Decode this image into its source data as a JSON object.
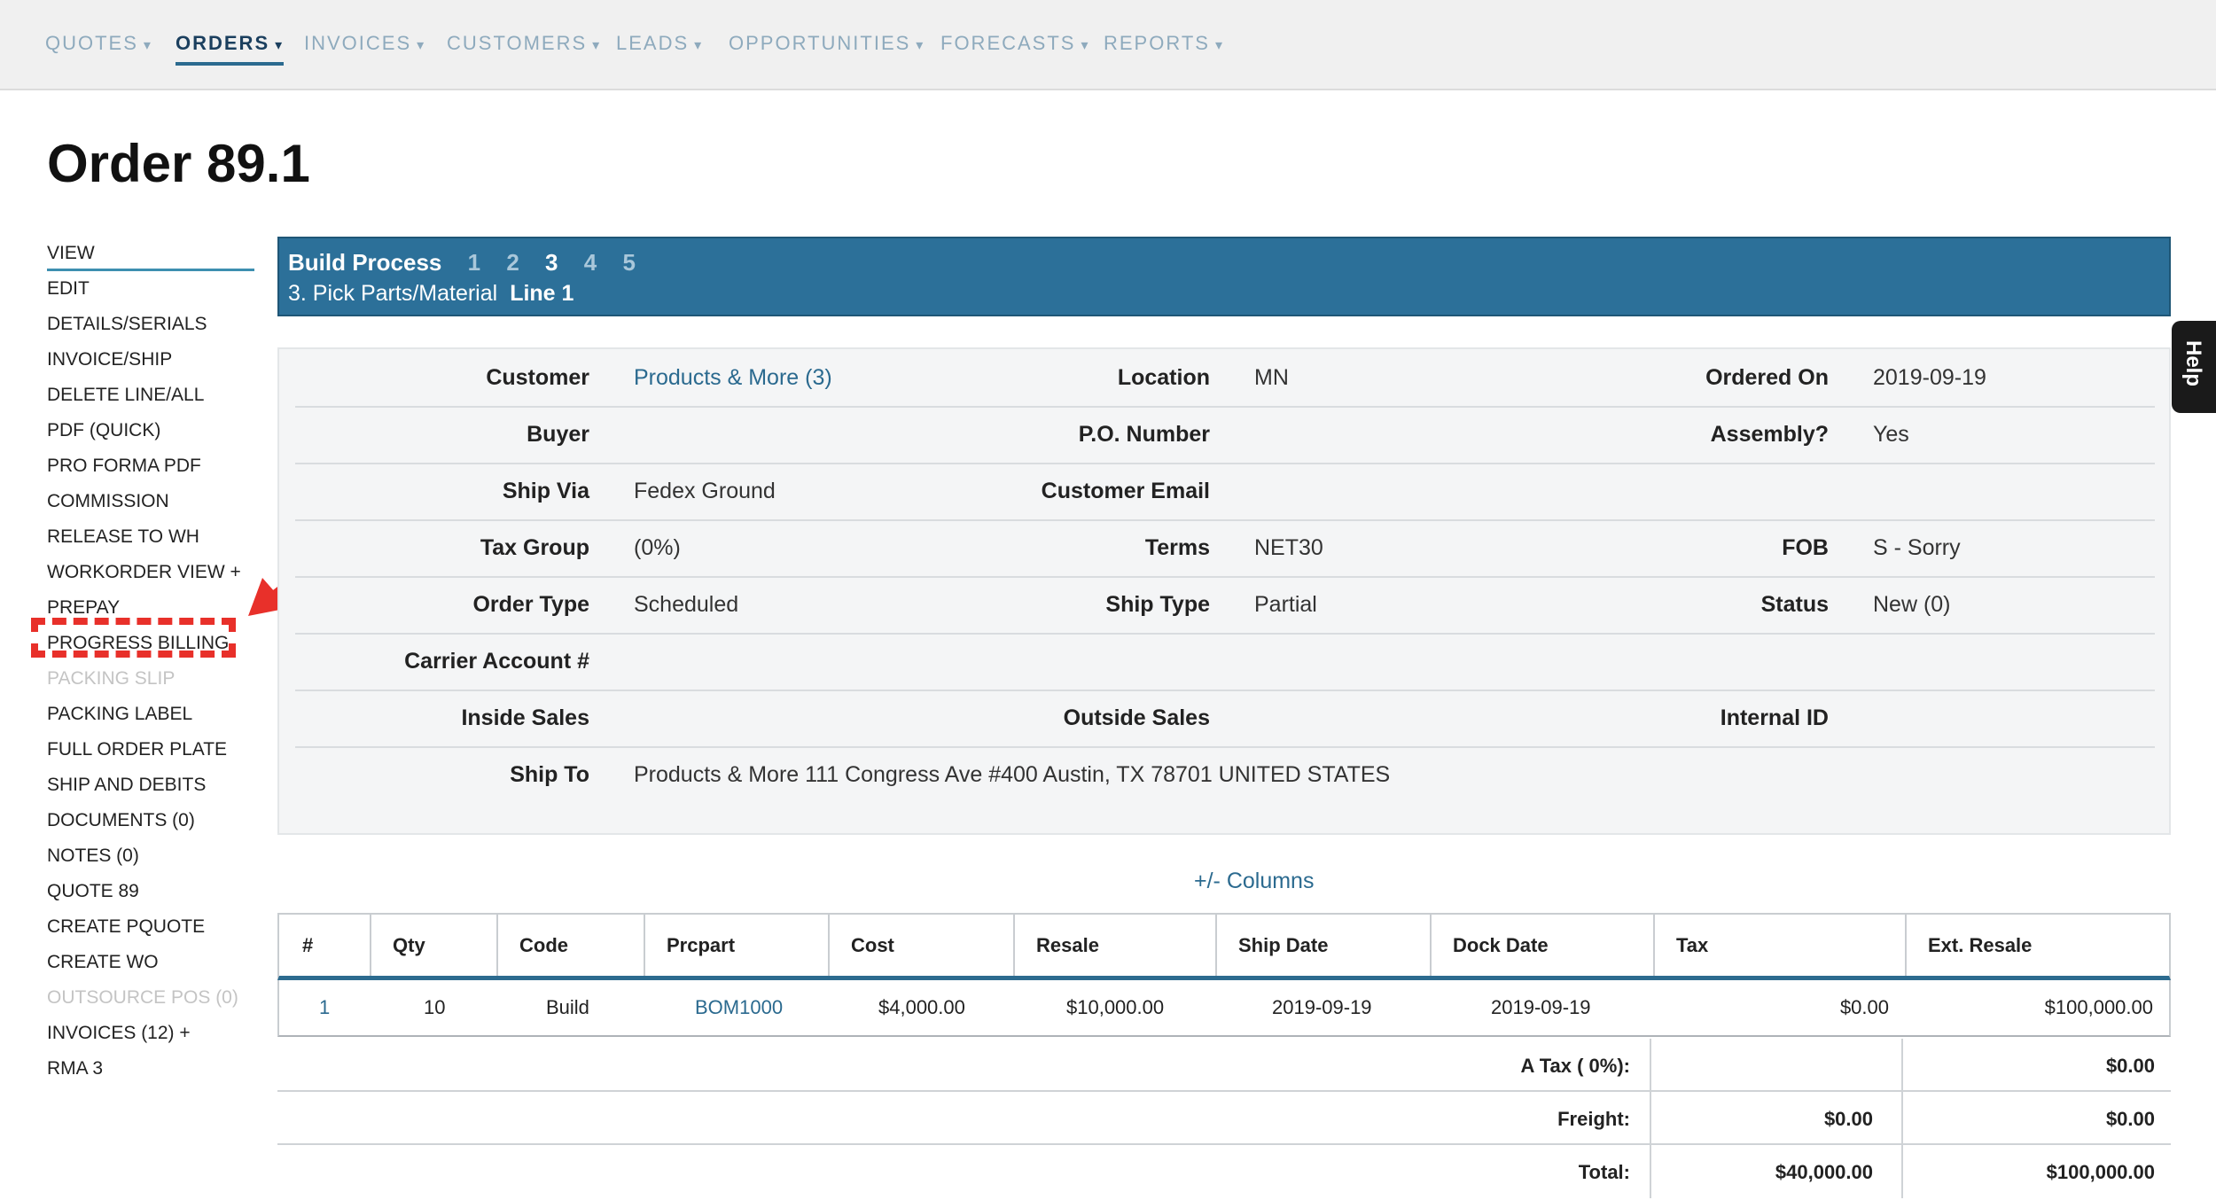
{
  "nav": [
    {
      "label": "QUOTES",
      "active": false
    },
    {
      "label": "ORDERS",
      "active": true
    },
    {
      "label": "INVOICES",
      "active": false
    },
    {
      "label": "CUSTOMERS",
      "active": false
    },
    {
      "label": "LEADS",
      "active": false
    },
    {
      "label": "OPPORTUNITIES",
      "active": false
    },
    {
      "label": "FORECASTS",
      "active": false
    },
    {
      "label": "REPORTS",
      "active": false
    }
  ],
  "nav_caret": "▾",
  "page": {
    "title": "Order 89.1"
  },
  "sidebar": [
    {
      "label": "VIEW",
      "state": "current"
    },
    {
      "label": "EDIT",
      "state": "normal"
    },
    {
      "label": "DETAILS/SERIALS",
      "state": "normal"
    },
    {
      "label": "INVOICE/SHIP",
      "state": "normal"
    },
    {
      "label": "DELETE LINE/ALL",
      "state": "normal"
    },
    {
      "label": "PDF (QUICK)",
      "state": "normal"
    },
    {
      "label": "PRO FORMA PDF",
      "state": "normal"
    },
    {
      "label": "COMMISSION",
      "state": "normal"
    },
    {
      "label": "RELEASE TO WH",
      "state": "normal"
    },
    {
      "label": "WORKORDER VIEW +",
      "state": "normal"
    },
    {
      "label": "PREPAY",
      "state": "normal"
    },
    {
      "label": "PROGRESS BILLING",
      "state": "normal"
    },
    {
      "label": "PACKING SLIP",
      "state": "disabled"
    },
    {
      "label": "PACKING LABEL",
      "state": "normal"
    },
    {
      "label": "FULL ORDER PLATE",
      "state": "normal"
    },
    {
      "label": "SHIP AND DEBITS",
      "state": "normal"
    },
    {
      "label": "DOCUMENTS (0)",
      "state": "normal"
    },
    {
      "label": "NOTES (0)",
      "state": "normal"
    },
    {
      "label": "QUOTE 89",
      "state": "normal"
    },
    {
      "label": "CREATE PQUOTE",
      "state": "normal"
    },
    {
      "label": "CREATE WO",
      "state": "normal"
    },
    {
      "label": "OUTSOURCE POS (0)",
      "state": "disabled"
    },
    {
      "label": "INVOICES (12) +",
      "state": "normal"
    },
    {
      "label": "RMA 3",
      "state": "normal"
    }
  ],
  "banner": {
    "title": "Build Process",
    "steps": [
      "1",
      "2",
      "3",
      "4",
      "5"
    ],
    "current_step": "3",
    "subtitle": "3. Pick Parts/Material",
    "line": "Line 1"
  },
  "help": {
    "label": "Help"
  },
  "details": [
    [
      {
        "label": "Customer",
        "value": "Products & More (3)",
        "link": true
      },
      {
        "label": "Location",
        "value": "MN"
      },
      {
        "label": "Ordered On",
        "value": "2019-09-19"
      }
    ],
    [
      {
        "label": "Buyer",
        "value": ""
      },
      {
        "label": "P.O. Number",
        "value": ""
      },
      {
        "label": "Assembly?",
        "value": "Yes"
      }
    ],
    [
      {
        "label": "Ship Via",
        "value": "Fedex Ground"
      },
      {
        "label": "Customer Email",
        "value": ""
      },
      {
        "label": "",
        "value": ""
      }
    ],
    [
      {
        "label": "Tax Group",
        "value": "(0%)"
      },
      {
        "label": "Terms",
        "value": "NET30"
      },
      {
        "label": "FOB",
        "value": "S - Sorry"
      }
    ],
    [
      {
        "label": "Order Type",
        "value": "Scheduled"
      },
      {
        "label": "Ship Type",
        "value": "Partial"
      },
      {
        "label": "Status",
        "value": "New (0)"
      }
    ],
    [
      {
        "label": "Carrier Account #",
        "value": ""
      },
      {
        "label": "",
        "value": ""
      },
      {
        "label": "",
        "value": ""
      }
    ],
    [
      {
        "label": "Inside Sales",
        "value": ""
      },
      {
        "label": "Outside Sales",
        "value": ""
      },
      {
        "label": "Internal ID",
        "value": ""
      }
    ],
    [
      {
        "label": "Ship To",
        "value": "Products & More 111 Congress Ave #400 Austin, TX 78701 UNITED STATES"
      },
      {
        "label": "",
        "value": ""
      },
      {
        "label": "",
        "value": ""
      }
    ]
  ],
  "columns_link": "+/- Columns",
  "table": {
    "headers": [
      "#",
      "Qty",
      "Code",
      "Prcpart",
      "Cost",
      "Resale",
      "Ship Date",
      "Dock Date",
      "Tax",
      "Ext. Resale"
    ],
    "rows": [
      [
        "1",
        "10",
        "Build",
        "BOM1000",
        "$4,000.00",
        "$10,000.00",
        "2019-09-19",
        "2019-09-19",
        "$0.00",
        "$100,000.00"
      ]
    ]
  },
  "totals": [
    {
      "label": "A Tax ( 0%):",
      "cost": "",
      "resale": "$0.00"
    },
    {
      "label": "Freight:",
      "cost": "$0.00",
      "resale": "$0.00"
    },
    {
      "label": "Total:",
      "cost": "$40,000.00",
      "resale": "$100,000.00"
    }
  ],
  "colors": {
    "accent": "#2c7099",
    "annotation": "#e8302a",
    "nav_inactive": "#8eaabd",
    "nav_active": "#1b3f5e"
  }
}
